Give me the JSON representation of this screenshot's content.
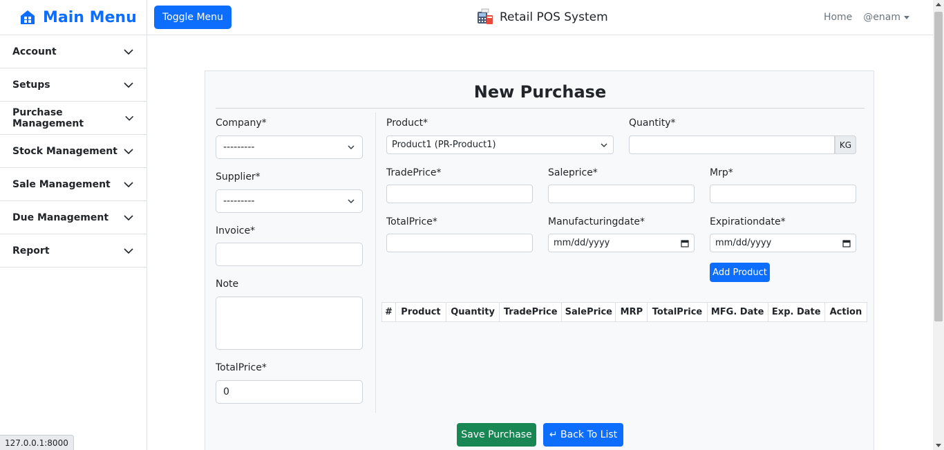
{
  "sidebar": {
    "title": "Main Menu",
    "items": [
      {
        "label": "Account"
      },
      {
        "label": "Setups"
      },
      {
        "label": "Purchase Management"
      },
      {
        "label": "Stock Management"
      },
      {
        "label": "Sale Management"
      },
      {
        "label": "Due Management"
      },
      {
        "label": "Report"
      }
    ]
  },
  "topbar": {
    "toggle_label": "Toggle Menu",
    "app_title": "Retail POS System",
    "home_label": "Home",
    "user_label": "@enam"
  },
  "form": {
    "title": "New Purchase",
    "company": {
      "label": "Company*",
      "value": "---------"
    },
    "supplier": {
      "label": "Supplier*",
      "value": "---------"
    },
    "invoice": {
      "label": "Invoice*",
      "value": ""
    },
    "note": {
      "label": "Note",
      "value": ""
    },
    "total_price": {
      "label": "TotalPrice*",
      "value": "0"
    },
    "product": {
      "label": "Product*",
      "value": "Product1 (PR-Product1)"
    },
    "quantity": {
      "label": "Quantity*",
      "value": "",
      "unit": "KG"
    },
    "trade_price": {
      "label": "TradePrice*",
      "value": ""
    },
    "sale_price": {
      "label": "Saleprice*",
      "value": ""
    },
    "mrp": {
      "label": "Mrp*",
      "value": ""
    },
    "item_total_price": {
      "label": "TotalPrice*",
      "value": ""
    },
    "manufacturing_date": {
      "label": "Manufacturingdate*",
      "placeholder": "mm/dd/yyyy"
    },
    "expiration_date": {
      "label": "Expirationdate*",
      "placeholder": "mm/dd/yyyy"
    },
    "add_product_label": "Add Product"
  },
  "table": {
    "headers": [
      "#",
      "Product",
      "Quantity",
      "TradePrice",
      "SalePrice",
      "MRP",
      "TotalPrice",
      "MFG. Date",
      "Exp. Date",
      "Action"
    ]
  },
  "actions": {
    "save_label": "Save Purchase",
    "back_label": "↵ Back To List"
  },
  "statusbar": {
    "url": "127.0.0.1:8000"
  },
  "colors": {
    "primary": "#0d6efd",
    "success": "#198754",
    "card_bg": "#f8f9fa"
  },
  "icons": {
    "brand": "home-icon",
    "app": "pos-terminal-icon",
    "nav": "chevron-down-icon",
    "date": "calendar-icon"
  }
}
